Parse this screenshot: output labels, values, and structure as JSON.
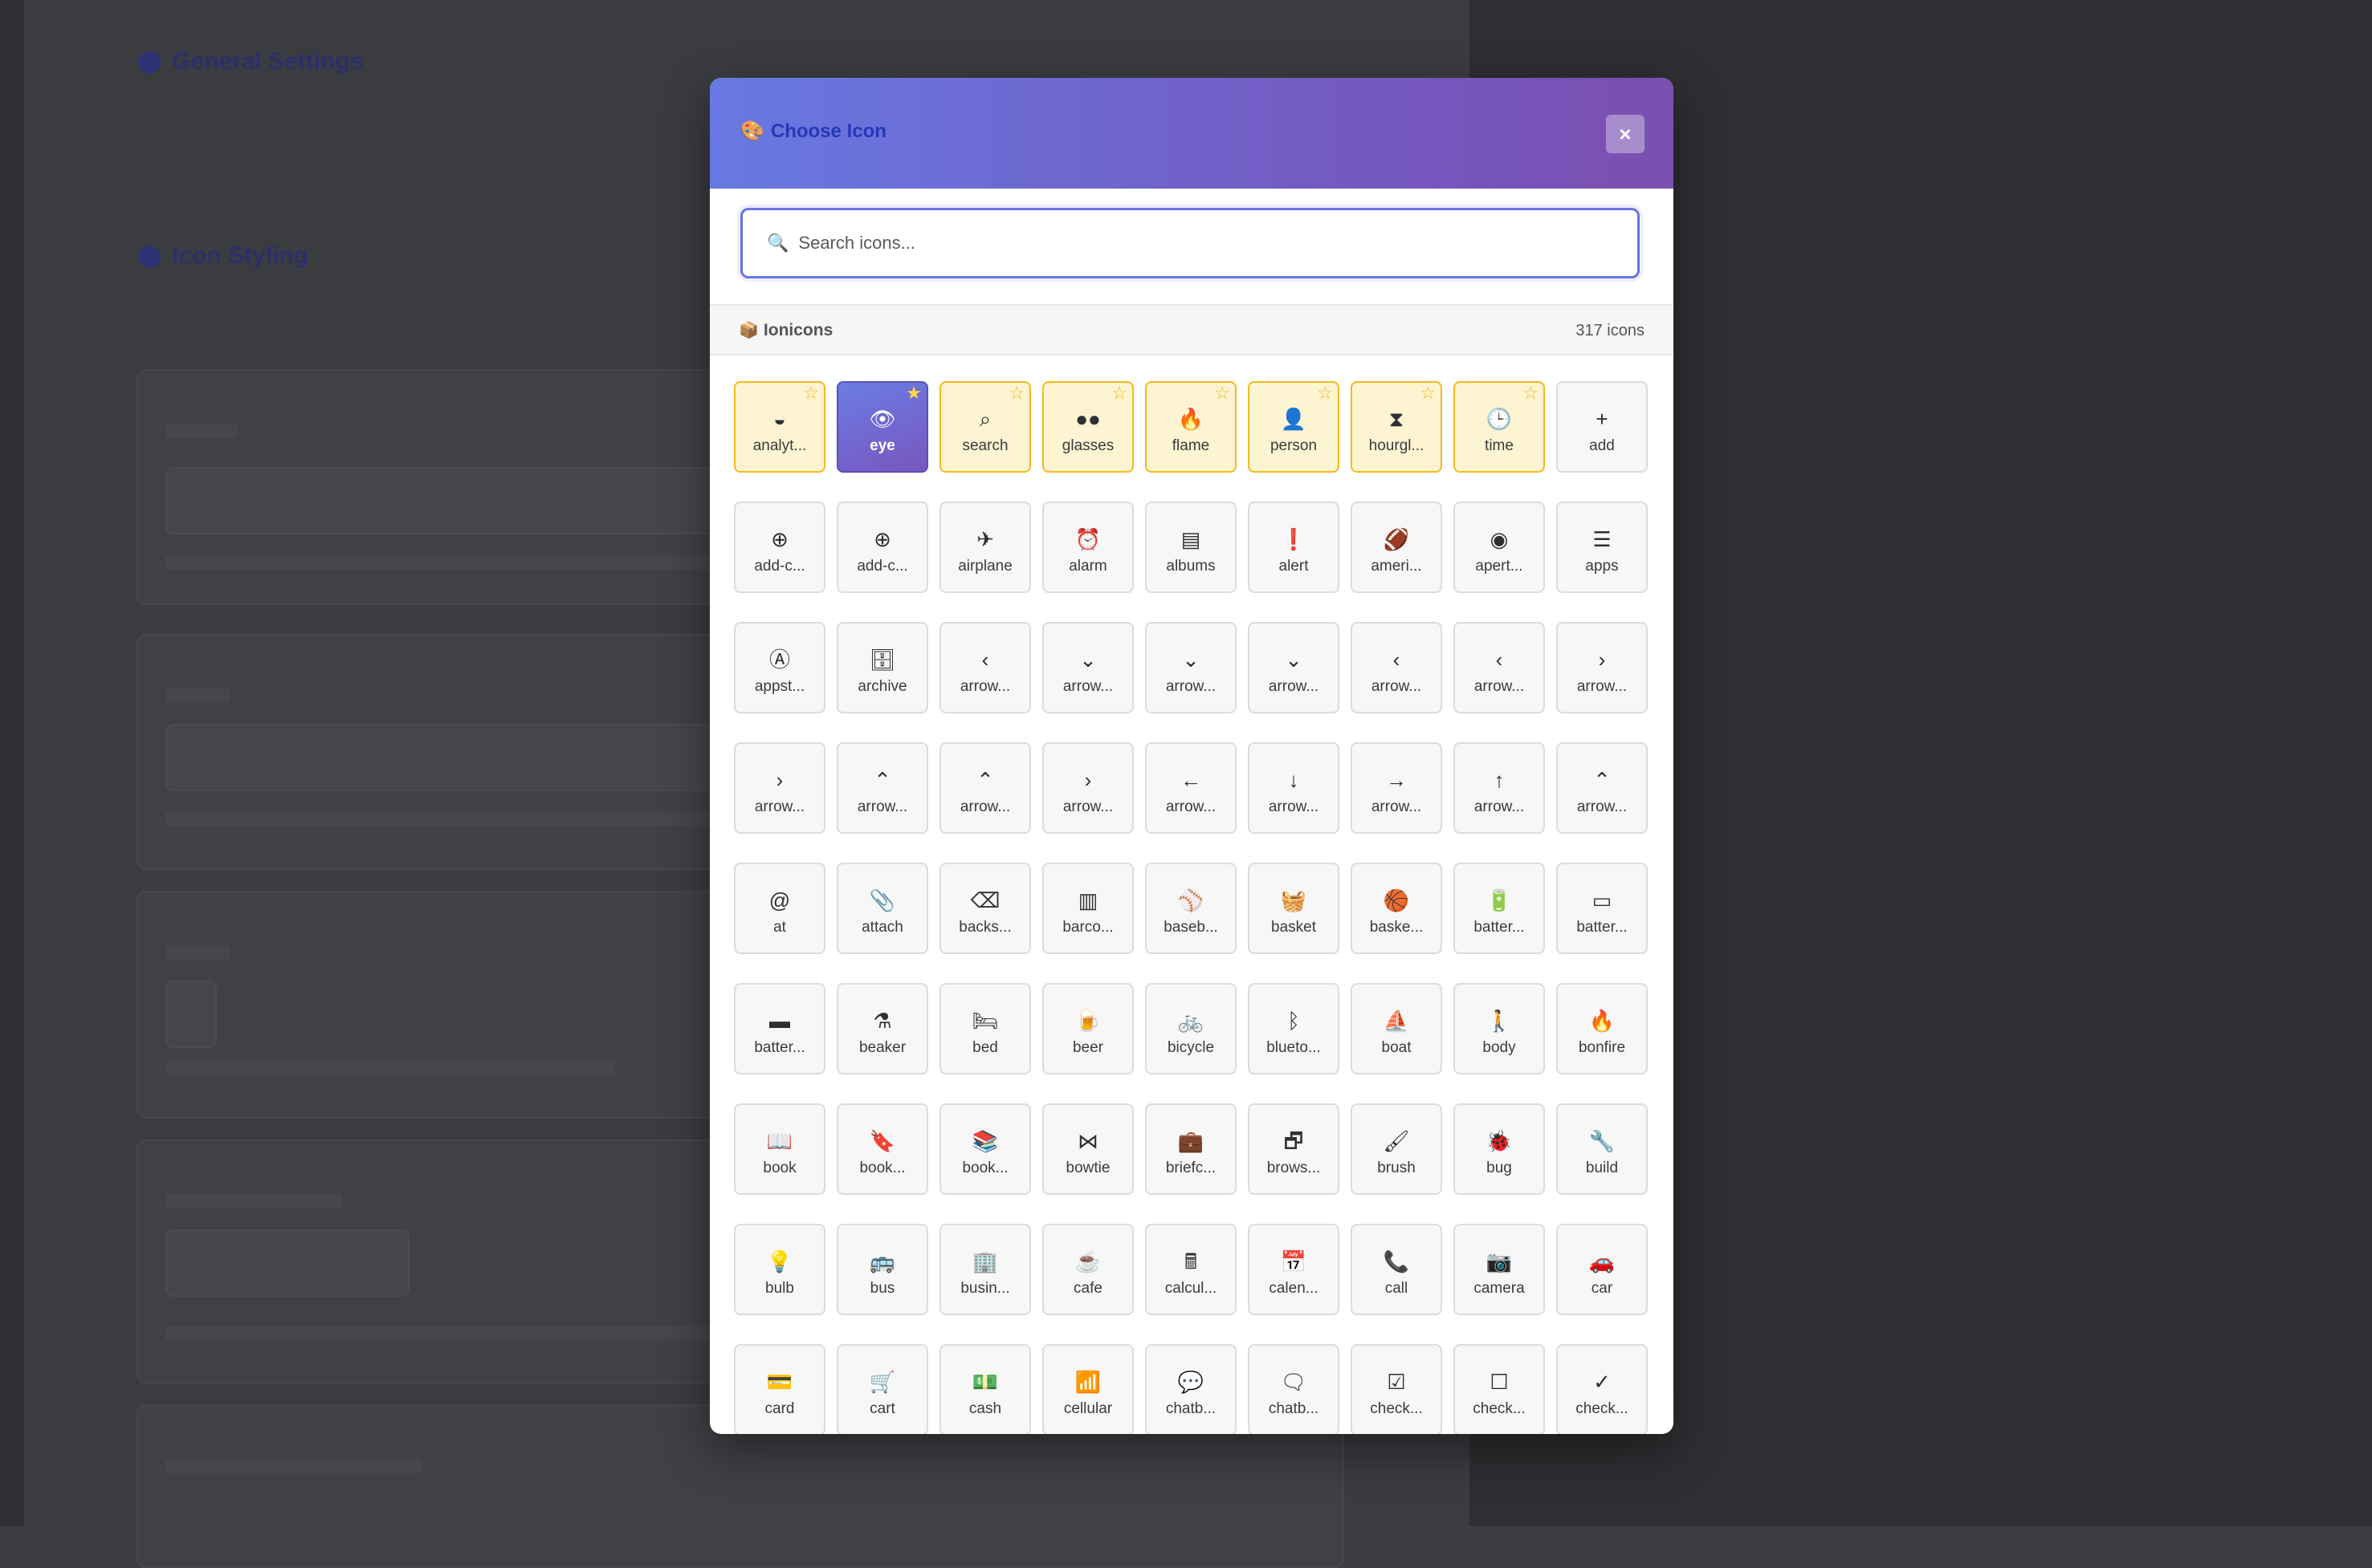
{
  "background": {
    "section_general": "General Settings",
    "section_styling": "Icon Styling"
  },
  "modal": {
    "title": "Choose Icon",
    "title_icon": "palette-emoji",
    "close_label": "×",
    "search": {
      "placeholder": "Search icons...",
      "value": ""
    },
    "library": {
      "name": "Ionicons",
      "icon": "package-emoji",
      "count_label": "317 icons"
    },
    "accent": "#6a74e3",
    "favorite_color": "#f4b91c",
    "icons": [
      {
        "label": "analyt...",
        "glyph": "◒",
        "fav": true
      },
      {
        "label": "eye",
        "glyph": "👁",
        "fav": true,
        "selected": true
      },
      {
        "label": "search",
        "glyph": "⌕",
        "fav": true
      },
      {
        "label": "glasses",
        "glyph": "●●",
        "fav": true
      },
      {
        "label": "flame",
        "glyph": "🔥",
        "fav": true
      },
      {
        "label": "person",
        "glyph": "👤",
        "fav": true
      },
      {
        "label": "hourgl...",
        "glyph": "⧗",
        "fav": true
      },
      {
        "label": "time",
        "glyph": "🕒",
        "fav": true
      },
      {
        "label": "add",
        "glyph": "+"
      },
      {
        "label": "add-c...",
        "glyph": "⊕"
      },
      {
        "label": "add-c...",
        "glyph": "⊕"
      },
      {
        "label": "airplane",
        "glyph": "✈"
      },
      {
        "label": "alarm",
        "glyph": "⏰"
      },
      {
        "label": "albums",
        "glyph": "▤"
      },
      {
        "label": "alert",
        "glyph": "❗"
      },
      {
        "label": "ameri...",
        "glyph": "🏈"
      },
      {
        "label": "apert...",
        "glyph": "◉"
      },
      {
        "label": "apps",
        "glyph": "☰"
      },
      {
        "label": "appst...",
        "glyph": "Ⓐ"
      },
      {
        "label": "archive",
        "glyph": "🗄"
      },
      {
        "label": "arrow...",
        "glyph": "‹"
      },
      {
        "label": "arrow...",
        "glyph": "⌄"
      },
      {
        "label": "arrow...",
        "glyph": "⌄"
      },
      {
        "label": "arrow...",
        "glyph": "⌄"
      },
      {
        "label": "arrow...",
        "glyph": "‹"
      },
      {
        "label": "arrow...",
        "glyph": "‹"
      },
      {
        "label": "arrow...",
        "glyph": "›"
      },
      {
        "label": "arrow...",
        "glyph": "›"
      },
      {
        "label": "arrow...",
        "glyph": "⌃"
      },
      {
        "label": "arrow...",
        "glyph": "⌃"
      },
      {
        "label": "arrow...",
        "glyph": "›"
      },
      {
        "label": "arrow...",
        "glyph": "←"
      },
      {
        "label": "arrow...",
        "glyph": "↓"
      },
      {
        "label": "arrow...",
        "glyph": "→"
      },
      {
        "label": "arrow...",
        "glyph": "↑"
      },
      {
        "label": "arrow...",
        "glyph": "⌃"
      },
      {
        "label": "at",
        "glyph": "@"
      },
      {
        "label": "attach",
        "glyph": "📎"
      },
      {
        "label": "backs...",
        "glyph": "⌫"
      },
      {
        "label": "barco...",
        "glyph": "▥"
      },
      {
        "label": "baseb...",
        "glyph": "⚾"
      },
      {
        "label": "basket",
        "glyph": "🧺"
      },
      {
        "label": "baske...",
        "glyph": "🏀"
      },
      {
        "label": "batter...",
        "glyph": "🔋"
      },
      {
        "label": "batter...",
        "glyph": "▭"
      },
      {
        "label": "batter...",
        "glyph": "▬"
      },
      {
        "label": "beaker",
        "glyph": "⚗"
      },
      {
        "label": "bed",
        "glyph": "🛏"
      },
      {
        "label": "beer",
        "glyph": "🍺"
      },
      {
        "label": "bicycle",
        "glyph": "🚲"
      },
      {
        "label": "blueto...",
        "glyph": "ᛒ"
      },
      {
        "label": "boat",
        "glyph": "⛵"
      },
      {
        "label": "body",
        "glyph": "🚶"
      },
      {
        "label": "bonfire",
        "glyph": "🔥"
      },
      {
        "label": "book",
        "glyph": "📖"
      },
      {
        "label": "book...",
        "glyph": "🔖"
      },
      {
        "label": "book...",
        "glyph": "📚"
      },
      {
        "label": "bowtie",
        "glyph": "⋈"
      },
      {
        "label": "briefc...",
        "glyph": "💼"
      },
      {
        "label": "brows...",
        "glyph": "🗗"
      },
      {
        "label": "brush",
        "glyph": "🖌"
      },
      {
        "label": "bug",
        "glyph": "🐞"
      },
      {
        "label": "build",
        "glyph": "🔧"
      },
      {
        "label": "bulb",
        "glyph": "💡"
      },
      {
        "label": "bus",
        "glyph": "🚌"
      },
      {
        "label": "busin...",
        "glyph": "🏢"
      },
      {
        "label": "cafe",
        "glyph": "☕"
      },
      {
        "label": "calcul...",
        "glyph": "🖩"
      },
      {
        "label": "calen...",
        "glyph": "📅"
      },
      {
        "label": "call",
        "glyph": "📞"
      },
      {
        "label": "camera",
        "glyph": "📷"
      },
      {
        "label": "car",
        "glyph": "🚗"
      },
      {
        "label": "card",
        "glyph": "💳"
      },
      {
        "label": "cart",
        "glyph": "🛒"
      },
      {
        "label": "cash",
        "glyph": "💵"
      },
      {
        "label": "cellular",
        "glyph": "📶"
      },
      {
        "label": "chatb...",
        "glyph": "💬"
      },
      {
        "label": "chatb...",
        "glyph": "🗨"
      },
      {
        "label": "check...",
        "glyph": "☑"
      },
      {
        "label": "check...",
        "glyph": "☐"
      },
      {
        "label": "check...",
        "glyph": "✓"
      }
    ]
  }
}
